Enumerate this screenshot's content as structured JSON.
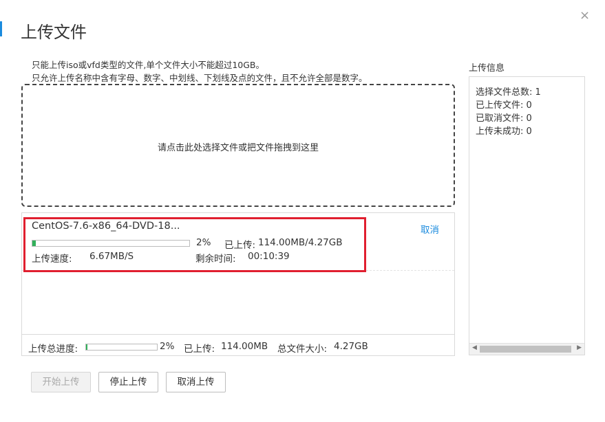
{
  "dialog": {
    "title": "上传文件",
    "close_glyph": "×",
    "tip_line1": "只能上传iso或vfd类型的文件,单个文件大小不能超过10GB。",
    "tip_line2": "只允许上传名称中含有字母、数字、中划线、下划线及点的文件，且不允许全部是数字。"
  },
  "dropzone": {
    "text": "请点击此处选择文件或把文件拖拽到这里"
  },
  "file": {
    "name": "CentOS-7.6-x86_64-DVD-18...",
    "cancel_label": "取消",
    "progress_fraction": 0.02,
    "progress_pct": "2%",
    "uploaded_label": "已上传:",
    "uploaded_value": "114.00MB/4.27GB",
    "speed_label": "上传速度:",
    "speed_value": "6.67MB/S",
    "remaining_label": "剩余时间:",
    "remaining_value": "00:10:39"
  },
  "totals": {
    "progress_label": "上传总进度:",
    "progress_fraction": 0.02,
    "progress_pct": "2%",
    "uploaded_label": "已上传:",
    "uploaded_value": "114.00MB",
    "total_label": "总文件大小:",
    "total_value": "4.27GB"
  },
  "info": {
    "title": "上传信息",
    "lines": [
      "选择文件总数: 1",
      "已上传文件: 0",
      "已取消文件: 0",
      "上传未成功: 0"
    ]
  },
  "buttons": {
    "start": "开始上传",
    "stop": "停止上传",
    "cancel": "取消上传"
  },
  "icons": {
    "close": "close-icon",
    "scroll_left": "chevron-left-icon",
    "scroll_right": "chevron-right-icon"
  },
  "colors": {
    "accent": "#1b8bde",
    "highlight": "#e01f2f",
    "progress": "#31b05a"
  }
}
